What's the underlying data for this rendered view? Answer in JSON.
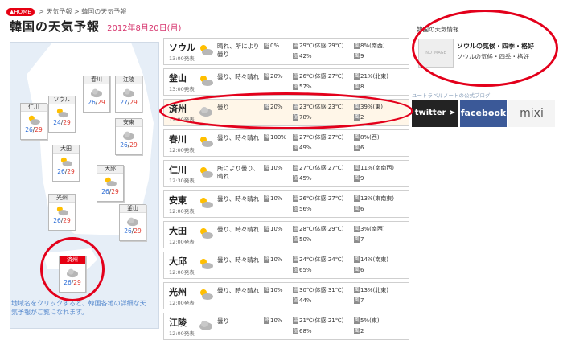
{
  "breadcrumb": {
    "home": "HOME",
    "level1": "天気予報",
    "level2": "韓国の天気予報",
    "sep": ">"
  },
  "title": "韓国の天気予報",
  "date": "2012年8月20日(月)",
  "map": {
    "note": "地域名をクリックすると、韓国各地の詳細な天気予報がご覧になれます。",
    "cities": [
      {
        "id": "incheon",
        "name": "仁川",
        "min": "26",
        "max": "29",
        "icon": "sun-cloud-icon"
      },
      {
        "id": "seoul",
        "name": "ソウル",
        "min": "24",
        "max": "29",
        "icon": "sun-cloud-icon"
      },
      {
        "id": "chuncheon",
        "name": "春川",
        "min": "26",
        "max": "29",
        "icon": "cloud-icon"
      },
      {
        "id": "gangneung",
        "name": "江陵",
        "min": "27",
        "max": "29",
        "icon": "cloud-icon"
      },
      {
        "id": "andong",
        "name": "安東",
        "min": "26",
        "max": "29",
        "icon": "cloud-icon"
      },
      {
        "id": "daejeon",
        "name": "大田",
        "min": "26",
        "max": "29",
        "icon": "sun-cloud-icon"
      },
      {
        "id": "daegu",
        "name": "大邱",
        "min": "26",
        "max": "29",
        "icon": "sun-cloud-icon"
      },
      {
        "id": "gwangju",
        "name": "光州",
        "min": "26",
        "max": "29",
        "icon": "sun-cloud-icon"
      },
      {
        "id": "busan",
        "name": "釜山",
        "min": "26",
        "max": "29",
        "icon": "cloud-icon"
      },
      {
        "id": "jeju",
        "name": "済州",
        "min": "26",
        "max": "29",
        "icon": "cloud-icon"
      }
    ]
  },
  "forecast": [
    {
      "city": "ソウル",
      "time": "13:00発表",
      "desc": "晴れ、所により曇り",
      "icon": "sun-cloud-icon",
      "rain_label": "降",
      "rain": "0%",
      "temp_label": "温",
      "temp": "29℃(体感:29℃)",
      "hum_label": "湿",
      "hum": "42%",
      "wind_label": "風",
      "wind": "8%(南西)",
      "wind2": "9"
    },
    {
      "city": "釜山",
      "time": "13:00発表",
      "desc": "曇り、時々晴れ",
      "icon": "sun-cloud-icon",
      "rain_label": "降",
      "rain": "20%",
      "temp_label": "温",
      "temp": "26℃(体感:27℃)",
      "hum_label": "湿",
      "hum": "57%",
      "wind_label": "風",
      "wind": "21%(北東)",
      "wind2": "8"
    },
    {
      "city": "済州",
      "time": "12:00発表",
      "desc": "曇り",
      "icon": "cloud-icon",
      "rain_label": "降",
      "rain": "20%",
      "temp_label": "温",
      "temp": "23℃(体感:23℃)",
      "hum_label": "湿",
      "hum": "78%",
      "wind_label": "風",
      "wind": "39%(東)",
      "wind2": "2"
    },
    {
      "city": "春川",
      "time": "12:00発表",
      "desc": "曇り、時々晴れ",
      "icon": "sun-cloud-icon",
      "rain_label": "降",
      "rain": "100%",
      "temp_label": "温",
      "temp": "27℃(体感:27℃)",
      "hum_label": "湿",
      "hum": "49%",
      "wind_label": "風",
      "wind": "8%(西)",
      "wind2": "6"
    },
    {
      "city": "仁川",
      "time": "12:30発表",
      "desc": "所により曇り、晴れ",
      "icon": "sun-cloud-icon",
      "rain_label": "降",
      "rain": "10%",
      "temp_label": "温",
      "temp": "27℃(体感:27℃)",
      "hum_label": "湿",
      "hum": "45%",
      "wind_label": "風",
      "wind": "11%(南南西)",
      "wind2": "9"
    },
    {
      "city": "安東",
      "time": "12:00発表",
      "desc": "曇り、時々晴れ",
      "icon": "sun-cloud-icon",
      "rain_label": "降",
      "rain": "10%",
      "temp_label": "温",
      "temp": "26℃(体感:27℃)",
      "hum_label": "湿",
      "hum": "56%",
      "wind_label": "風",
      "wind": "13%(東南東)",
      "wind2": "6"
    },
    {
      "city": "大田",
      "time": "12:00発表",
      "desc": "曇り、時々晴れ",
      "icon": "sun-cloud-icon",
      "rain_label": "降",
      "rain": "10%",
      "temp_label": "温",
      "temp": "28℃(体感:29℃)",
      "hum_label": "湿",
      "hum": "50%",
      "wind_label": "風",
      "wind": "3%(南西)",
      "wind2": "7"
    },
    {
      "city": "大邱",
      "time": "12:00発表",
      "desc": "曇り、時々晴れ",
      "icon": "sun-cloud-icon",
      "rain_label": "降",
      "rain": "10%",
      "temp_label": "温",
      "temp": "24℃(体感:24℃)",
      "hum_label": "湿",
      "hum": "65%",
      "wind_label": "風",
      "wind": "14%(南東)",
      "wind2": "6"
    },
    {
      "city": "光州",
      "time": "12:00発表",
      "desc": "曇り、時々晴れ",
      "icon": "sun-cloud-icon",
      "rain_label": "降",
      "rain": "10%",
      "temp_label": "温",
      "temp": "30℃(体感:31℃)",
      "hum_label": "湿",
      "hum": "44%",
      "wind_label": "風",
      "wind": "13%(北東)",
      "wind2": "7"
    },
    {
      "city": "江陵",
      "time": "12:00発表",
      "desc": "曇り",
      "icon": "cloud-icon",
      "rain_label": "降",
      "rain": "10%",
      "temp_label": "温",
      "temp": "21℃(体感:21℃)",
      "hum_label": "湿",
      "hum": "68%",
      "wind_label": "風",
      "wind": "5%(東)",
      "wind2": "2"
    }
  ],
  "sidebar": {
    "info_title": "韓国の天気情報",
    "no_image": "NO IMAGE",
    "info_link": "ソウルの気候・四季・格好",
    "info_sub": "ソウルの気候・四季・格好",
    "blog_title": "ユートラベルノートの公式ブログ",
    "twitter": "twitter",
    "facebook": "facebook",
    "mixi": "mixi"
  }
}
